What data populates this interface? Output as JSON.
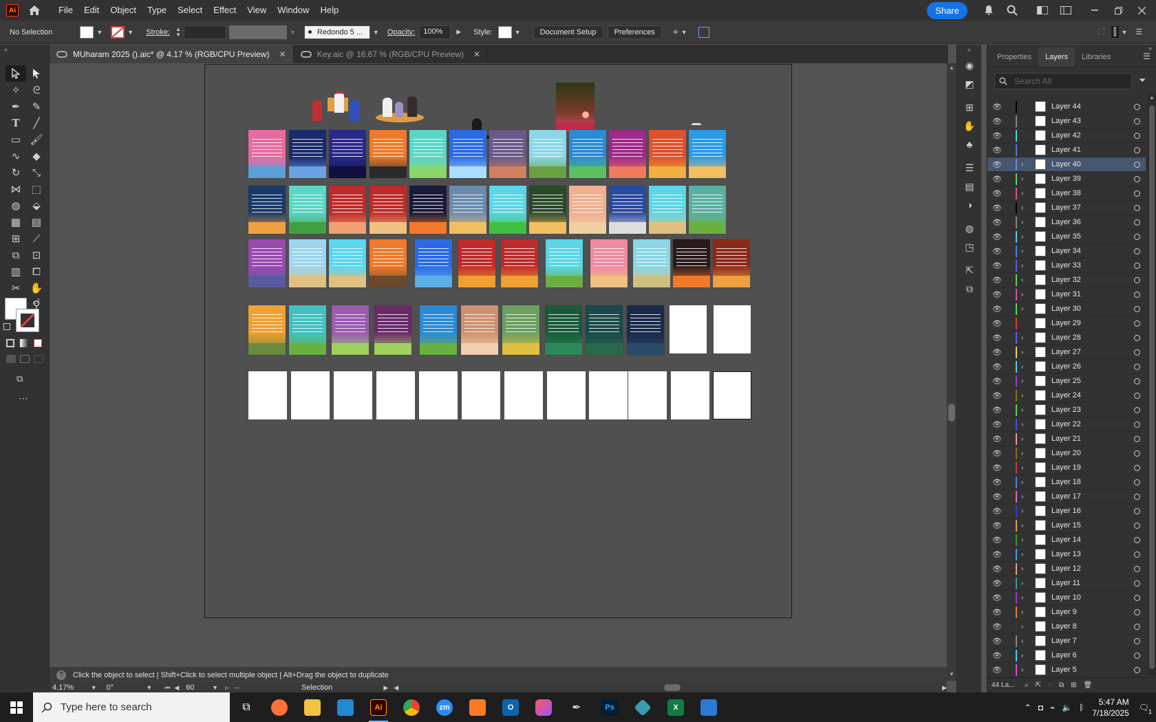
{
  "app": {
    "logo": "Ai",
    "menus": [
      "File",
      "Edit",
      "Object",
      "Type",
      "Select",
      "Effect",
      "View",
      "Window",
      "Help"
    ],
    "share_label": "Share"
  },
  "control": {
    "selection": "No Selection",
    "stroke_label": "Stroke:",
    "brush_name": "Redondo 5 ...",
    "opacity_label": "Opacity:",
    "opacity_value": "100%",
    "style_label": "Style:",
    "doc_setup": "Document Setup",
    "preferences": "Preferences"
  },
  "tabs": [
    {
      "label": "MUharam 2025 ().aic* @ 4.17 % (RGB/CPU Preview)"
    },
    {
      "label": "Key.aic @ 16.67 % (RGB/CPU Preview)"
    }
  ],
  "status": {
    "tip": "Click the object to select  |  Shift+Click to select multiple object  |  Alt+Drag the object to duplicate",
    "zoom": "4.17%",
    "rotation": "0°",
    "artboard_num": "60",
    "tool_name": "Selection"
  },
  "panel": {
    "tabs": [
      "Properties",
      "Layers",
      "Libraries"
    ],
    "search_placeholder": "Search All",
    "footer_count": "44 La...",
    "layers": [
      {
        "name": "Layer 44",
        "color": "#000000",
        "expand": false
      },
      {
        "name": "Layer 43",
        "color": "#888888",
        "expand": false
      },
      {
        "name": "Layer 42",
        "color": "#4fd3e6",
        "expand": false
      },
      {
        "name": "Layer 41",
        "color": "#4f7ee6",
        "expand": false
      },
      {
        "name": "Layer 40",
        "color": "#5e8ff0",
        "expand": true,
        "selected": true
      },
      {
        "name": "Layer 39",
        "color": "#5fd25f",
        "expand": true
      },
      {
        "name": "Layer 38",
        "color": "#d6579e",
        "expand": true
      },
      {
        "name": "Layer 37",
        "color": "#000000",
        "expand": true
      },
      {
        "name": "Layer 36",
        "color": "#888888",
        "expand": true
      },
      {
        "name": "Layer 35",
        "color": "#4fd3e6",
        "expand": true
      },
      {
        "name": "Layer 34",
        "color": "#4f7ee6",
        "expand": true
      },
      {
        "name": "Layer 33",
        "color": "#5e5ee6",
        "expand": true
      },
      {
        "name": "Layer 32",
        "color": "#5fd25f",
        "expand": true
      },
      {
        "name": "Layer 31",
        "color": "#d6579e",
        "expand": true
      },
      {
        "name": "Layer 30",
        "color": "#5fd25f",
        "expand": true
      },
      {
        "name": "Layer 29",
        "color": "#d63a3a",
        "expand": false
      },
      {
        "name": "Layer 28",
        "color": "#5e5ee6",
        "expand": true
      },
      {
        "name": "Layer 27",
        "color": "#e6d94f",
        "expand": true
      },
      {
        "name": "Layer 26",
        "color": "#4fd3e6",
        "expand": true
      },
      {
        "name": "Layer 25",
        "color": "#9c3ac8",
        "expand": true
      },
      {
        "name": "Layer 24",
        "color": "#8a6a2a",
        "expand": true
      },
      {
        "name": "Layer 23",
        "color": "#5fd25f",
        "expand": true
      },
      {
        "name": "Layer 22",
        "color": "#3a5ad6",
        "expand": true
      },
      {
        "name": "Layer 21",
        "color": "#e6a07a",
        "expand": true
      },
      {
        "name": "Layer 20",
        "color": "#8a6a2a",
        "expand": true
      },
      {
        "name": "Layer 19",
        "color": "#c83a3a",
        "expand": true
      },
      {
        "name": "Layer 18",
        "color": "#4f7ee6",
        "expand": true
      },
      {
        "name": "Layer 17",
        "color": "#e66ab0",
        "expand": true
      },
      {
        "name": "Layer 16",
        "color": "#3a3ac8",
        "expand": true
      },
      {
        "name": "Layer 15",
        "color": "#e6a03a",
        "expand": true
      },
      {
        "name": "Layer 14",
        "color": "#3a9a3a",
        "expand": true
      },
      {
        "name": "Layer 13",
        "color": "#4f9ae6",
        "expand": true
      },
      {
        "name": "Layer 12",
        "color": "#e6a07a",
        "expand": true
      },
      {
        "name": "Layer 11",
        "color": "#3a9a9a",
        "expand": true
      },
      {
        "name": "Layer 10",
        "color": "#9c3ac8",
        "expand": true
      },
      {
        "name": "Layer 9",
        "color": "#e67a3a",
        "expand": true
      },
      {
        "name": "Layer 8",
        "color": "#3a3a3a",
        "expand": true
      },
      {
        "name": "Layer 7",
        "color": "#888888",
        "expand": true
      },
      {
        "name": "Layer 6",
        "color": "#4fd3e6",
        "expand": true
      },
      {
        "name": "Layer 5",
        "color": "#d64fd6",
        "expand": true
      }
    ]
  },
  "taskbar": {
    "search_placeholder": "Type here to search",
    "time": "5:47 AM",
    "date": "7/18/2025",
    "notif_count": "1"
  },
  "colors": {
    "accent": "#1473e6",
    "selected_layer": "#46566e"
  }
}
